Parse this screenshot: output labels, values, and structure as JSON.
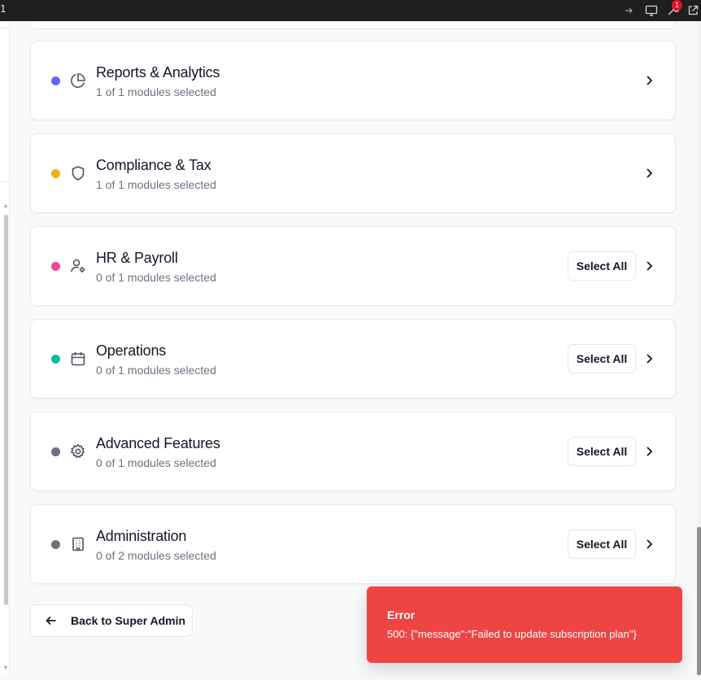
{
  "topbar": {
    "index_text": "1",
    "notification_count": "1"
  },
  "categories": [
    {
      "title": "Reports & Analytics",
      "subtitle": "1 of 1 modules selected",
      "dot_color": "#6366f1",
      "icon": "pie-chart-icon",
      "show_select_all": false
    },
    {
      "title": "Compliance & Tax",
      "subtitle": "1 of 1 modules selected",
      "dot_color": "#eab308",
      "icon": "shield-icon",
      "show_select_all": false
    },
    {
      "title": "HR & Payroll",
      "subtitle": "0 of 1 modules selected",
      "dot_color": "#ec4899",
      "icon": "user-cog-icon",
      "show_select_all": true
    },
    {
      "title": "Operations",
      "subtitle": "0 of 1 modules selected",
      "dot_color": "#14b8a6",
      "icon": "calendar-icon",
      "show_select_all": true
    },
    {
      "title": "Advanced Features",
      "subtitle": "0 of 1 modules selected",
      "dot_color": "#6b7280",
      "icon": "gear-icon",
      "show_select_all": true
    },
    {
      "title": "Administration",
      "subtitle": "0 of 2 modules selected",
      "dot_color": "#6b7280",
      "icon": "building-icon",
      "show_select_all": true
    }
  ],
  "select_all_label": "Select All",
  "back_button_label": "Back to Super Admin",
  "toast": {
    "title": "Error",
    "message": "500: {\"message\":\"Failed to update subscription plan\"}",
    "color": "#ef4444"
  }
}
